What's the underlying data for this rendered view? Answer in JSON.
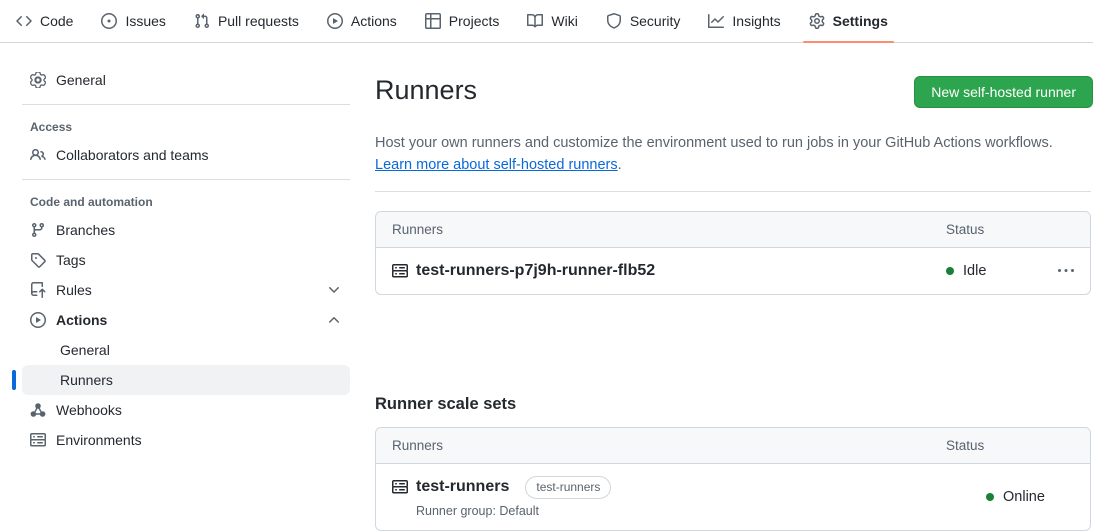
{
  "nav": {
    "items": [
      {
        "label": "Code",
        "icon": "code-icon"
      },
      {
        "label": "Issues",
        "icon": "issue-opened-icon"
      },
      {
        "label": "Pull requests",
        "icon": "git-pull-request-icon"
      },
      {
        "label": "Actions",
        "icon": "play-icon"
      },
      {
        "label": "Projects",
        "icon": "table-icon"
      },
      {
        "label": "Wiki",
        "icon": "book-icon"
      },
      {
        "label": "Security",
        "icon": "shield-icon"
      },
      {
        "label": "Insights",
        "icon": "graph-icon"
      },
      {
        "label": "Settings",
        "icon": "gear-icon",
        "active": true
      }
    ]
  },
  "sidebar": {
    "sections": [
      {
        "label": "",
        "items": [
          {
            "label": "General",
            "icon": "gear-icon"
          }
        ]
      },
      {
        "label": "Access",
        "items": [
          {
            "label": "Collaborators and teams",
            "icon": "people-icon"
          }
        ]
      },
      {
        "label": "Code and automation",
        "items": [
          {
            "label": "Branches",
            "icon": "git-branch-icon"
          },
          {
            "label": "Tags",
            "icon": "tag-icon"
          },
          {
            "label": "Rules",
            "icon": "rules-icon",
            "chevron": "down"
          },
          {
            "label": "Actions",
            "icon": "play-icon",
            "chevron": "up",
            "expanded": true
          },
          {
            "label": "General",
            "sub": true
          },
          {
            "label": "Runners",
            "sub": true,
            "selected": true
          },
          {
            "label": "Webhooks",
            "icon": "webhook-icon"
          },
          {
            "label": "Environments",
            "icon": "server-icon"
          }
        ]
      }
    ]
  },
  "main": {
    "title": "Runners",
    "new_runner_button": "New self-hosted runner",
    "description": "Host your own runners and customize the environment used to run jobs in your GitHub Actions workflows.",
    "learn_more_link": "Learn more about self-hosted runners",
    "learn_more_suffix": ".",
    "runners_table": {
      "headers": [
        "Runners",
        "Status"
      ],
      "rows": [
        {
          "name": "test-runners-p7j9h-runner-flb52",
          "status": "Idle",
          "menu": "kebab-menu"
        }
      ]
    },
    "scale_sets_title": "Runner scale sets",
    "scale_sets_table": {
      "headers": [
        "Runners",
        "Status"
      ],
      "rows": [
        {
          "name": "test-runners",
          "badge": "test-runners",
          "group": "Runner group: Default",
          "status": "Online"
        }
      ]
    }
  },
  "colors": {
    "button_green": "#2da44e",
    "status_green": "#1a7f37",
    "link_blue": "#0969da",
    "active_tab_underline": "#fd8c73",
    "selected_item_bar": "#0969da"
  }
}
